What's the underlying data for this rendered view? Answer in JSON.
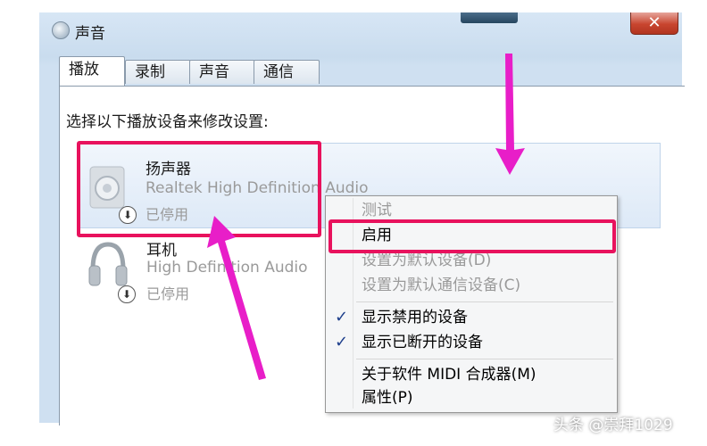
{
  "window": {
    "title": "声音",
    "close_glyph": "✕"
  },
  "tabs": [
    {
      "label": "播放",
      "active": true
    },
    {
      "label": "录制",
      "active": false
    },
    {
      "label": "声音",
      "active": false
    },
    {
      "label": "通信",
      "active": false
    }
  ],
  "instruction": "选择以下播放设备来修改设置:",
  "devices": [
    {
      "name": "扬声器",
      "description": "Realtek High Definition Audio",
      "status": "已停用",
      "icon": "speaker-icon",
      "selected": true
    },
    {
      "name": "耳机",
      "description": "High Definition Audio",
      "status": "已停用",
      "icon": "headphones-icon",
      "selected": false
    }
  ],
  "context_menu": {
    "items": [
      {
        "label": "测试",
        "disabled": true,
        "checked": false
      },
      {
        "label": "启用",
        "disabled": false,
        "checked": false,
        "highlighted": true
      },
      {
        "label": "设置为默认设备(D)",
        "disabled": true,
        "checked": false
      },
      {
        "label": "设置为默认通信设备(C)",
        "disabled": true,
        "checked": false
      },
      {
        "label": "显示禁用的设备",
        "disabled": false,
        "checked": true
      },
      {
        "label": "显示已断开的设备",
        "disabled": false,
        "checked": true
      },
      {
        "label": "关于软件 MIDI 合成器(M)",
        "disabled": false,
        "checked": false
      },
      {
        "label": "属性(P)",
        "disabled": false,
        "checked": false
      }
    ],
    "check_glyph": "✓"
  },
  "watermark": "头条 @崇拜1029",
  "colors": {
    "highlight": "#e8125d",
    "arrow": "#e81ec8",
    "disabled_text": "#9a9a9a"
  }
}
